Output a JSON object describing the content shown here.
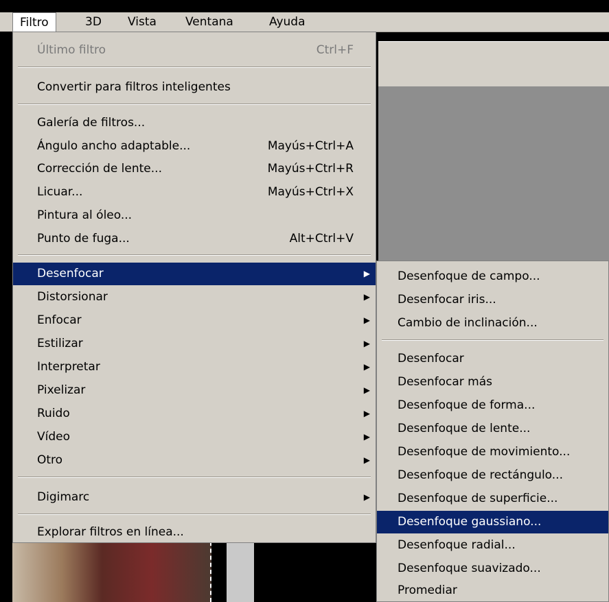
{
  "menubar": {
    "items": [
      {
        "label": "Filtro"
      },
      {
        "label": "3D"
      },
      {
        "label": "Vista"
      },
      {
        "label": "Ventana"
      },
      {
        "label": "Ayuda"
      }
    ]
  },
  "menu": {
    "items": [
      {
        "label": "Último filtro",
        "shortcut": "Ctrl+F"
      },
      {
        "label": "Convertir para filtros inteligentes"
      },
      {
        "label": "Galería de filtros..."
      },
      {
        "label": "Ángulo ancho adaptable...",
        "shortcut": "Mayús+Ctrl+A"
      },
      {
        "label": "Corrección de lente...",
        "shortcut": "Mayús+Ctrl+R"
      },
      {
        "label": "Licuar...",
        "shortcut": "Mayús+Ctrl+X"
      },
      {
        "label": "Pintura al óleo..."
      },
      {
        "label": "Punto de fuga...",
        "shortcut": "Alt+Ctrl+V"
      },
      {
        "label": "Desenfocar"
      },
      {
        "label": "Distorsionar"
      },
      {
        "label": "Enfocar"
      },
      {
        "label": "Estilizar"
      },
      {
        "label": "Interpretar"
      },
      {
        "label": "Pixelizar"
      },
      {
        "label": "Ruido"
      },
      {
        "label": "Vídeo"
      },
      {
        "label": "Otro"
      },
      {
        "label": "Digimarc"
      },
      {
        "label": "Explorar filtros en línea..."
      }
    ],
    "arrow": "▶"
  },
  "submenu": {
    "items": [
      {
        "label": "Desenfoque de campo..."
      },
      {
        "label": "Desenfocar iris..."
      },
      {
        "label": "Cambio de inclinación..."
      },
      {
        "label": "Desenfocar"
      },
      {
        "label": "Desenfocar más"
      },
      {
        "label": "Desenfoque de forma..."
      },
      {
        "label": "Desenfoque de lente..."
      },
      {
        "label": "Desenfoque de movimiento..."
      },
      {
        "label": "Desenfoque de rectángulo..."
      },
      {
        "label": "Desenfoque de superficie..."
      },
      {
        "label": "Desenfoque gaussiano..."
      },
      {
        "label": "Desenfoque radial..."
      },
      {
        "label": "Desenfoque suavizado..."
      },
      {
        "label": "Promediar"
      }
    ]
  },
  "colors": {
    "highlight": "#0a246a",
    "menu_bg": "#d4d0c8",
    "canvas": "#8e8e8e"
  }
}
